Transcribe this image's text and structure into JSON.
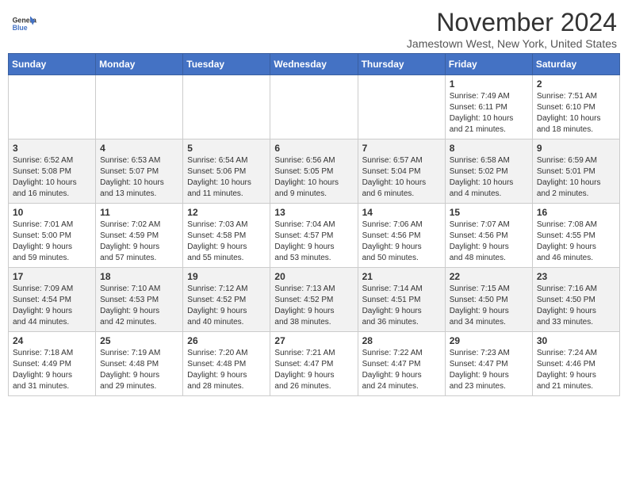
{
  "header": {
    "logo_line1": "General",
    "logo_line2": "Blue",
    "month_title": "November 2024",
    "location": "Jamestown West, New York, United States"
  },
  "weekdays": [
    "Sunday",
    "Monday",
    "Tuesday",
    "Wednesday",
    "Thursday",
    "Friday",
    "Saturday"
  ],
  "weeks": [
    [
      {
        "day": "",
        "info": ""
      },
      {
        "day": "",
        "info": ""
      },
      {
        "day": "",
        "info": ""
      },
      {
        "day": "",
        "info": ""
      },
      {
        "day": "",
        "info": ""
      },
      {
        "day": "1",
        "info": "Sunrise: 7:49 AM\nSunset: 6:11 PM\nDaylight: 10 hours\nand 21 minutes."
      },
      {
        "day": "2",
        "info": "Sunrise: 7:51 AM\nSunset: 6:10 PM\nDaylight: 10 hours\nand 18 minutes."
      }
    ],
    [
      {
        "day": "3",
        "info": "Sunrise: 6:52 AM\nSunset: 5:08 PM\nDaylight: 10 hours\nand 16 minutes."
      },
      {
        "day": "4",
        "info": "Sunrise: 6:53 AM\nSunset: 5:07 PM\nDaylight: 10 hours\nand 13 minutes."
      },
      {
        "day": "5",
        "info": "Sunrise: 6:54 AM\nSunset: 5:06 PM\nDaylight: 10 hours\nand 11 minutes."
      },
      {
        "day": "6",
        "info": "Sunrise: 6:56 AM\nSunset: 5:05 PM\nDaylight: 10 hours\nand 9 minutes."
      },
      {
        "day": "7",
        "info": "Sunrise: 6:57 AM\nSunset: 5:04 PM\nDaylight: 10 hours\nand 6 minutes."
      },
      {
        "day": "8",
        "info": "Sunrise: 6:58 AM\nSunset: 5:02 PM\nDaylight: 10 hours\nand 4 minutes."
      },
      {
        "day": "9",
        "info": "Sunrise: 6:59 AM\nSunset: 5:01 PM\nDaylight: 10 hours\nand 2 minutes."
      }
    ],
    [
      {
        "day": "10",
        "info": "Sunrise: 7:01 AM\nSunset: 5:00 PM\nDaylight: 9 hours\nand 59 minutes."
      },
      {
        "day": "11",
        "info": "Sunrise: 7:02 AM\nSunset: 4:59 PM\nDaylight: 9 hours\nand 57 minutes."
      },
      {
        "day": "12",
        "info": "Sunrise: 7:03 AM\nSunset: 4:58 PM\nDaylight: 9 hours\nand 55 minutes."
      },
      {
        "day": "13",
        "info": "Sunrise: 7:04 AM\nSunset: 4:57 PM\nDaylight: 9 hours\nand 53 minutes."
      },
      {
        "day": "14",
        "info": "Sunrise: 7:06 AM\nSunset: 4:56 PM\nDaylight: 9 hours\nand 50 minutes."
      },
      {
        "day": "15",
        "info": "Sunrise: 7:07 AM\nSunset: 4:56 PM\nDaylight: 9 hours\nand 48 minutes."
      },
      {
        "day": "16",
        "info": "Sunrise: 7:08 AM\nSunset: 4:55 PM\nDaylight: 9 hours\nand 46 minutes."
      }
    ],
    [
      {
        "day": "17",
        "info": "Sunrise: 7:09 AM\nSunset: 4:54 PM\nDaylight: 9 hours\nand 44 minutes."
      },
      {
        "day": "18",
        "info": "Sunrise: 7:10 AM\nSunset: 4:53 PM\nDaylight: 9 hours\nand 42 minutes."
      },
      {
        "day": "19",
        "info": "Sunrise: 7:12 AM\nSunset: 4:52 PM\nDaylight: 9 hours\nand 40 minutes."
      },
      {
        "day": "20",
        "info": "Sunrise: 7:13 AM\nSunset: 4:52 PM\nDaylight: 9 hours\nand 38 minutes."
      },
      {
        "day": "21",
        "info": "Sunrise: 7:14 AM\nSunset: 4:51 PM\nDaylight: 9 hours\nand 36 minutes."
      },
      {
        "day": "22",
        "info": "Sunrise: 7:15 AM\nSunset: 4:50 PM\nDaylight: 9 hours\nand 34 minutes."
      },
      {
        "day": "23",
        "info": "Sunrise: 7:16 AM\nSunset: 4:50 PM\nDaylight: 9 hours\nand 33 minutes."
      }
    ],
    [
      {
        "day": "24",
        "info": "Sunrise: 7:18 AM\nSunset: 4:49 PM\nDaylight: 9 hours\nand 31 minutes."
      },
      {
        "day": "25",
        "info": "Sunrise: 7:19 AM\nSunset: 4:48 PM\nDaylight: 9 hours\nand 29 minutes."
      },
      {
        "day": "26",
        "info": "Sunrise: 7:20 AM\nSunset: 4:48 PM\nDaylight: 9 hours\nand 28 minutes."
      },
      {
        "day": "27",
        "info": "Sunrise: 7:21 AM\nSunset: 4:47 PM\nDaylight: 9 hours\nand 26 minutes."
      },
      {
        "day": "28",
        "info": "Sunrise: 7:22 AM\nSunset: 4:47 PM\nDaylight: 9 hours\nand 24 minutes."
      },
      {
        "day": "29",
        "info": "Sunrise: 7:23 AM\nSunset: 4:47 PM\nDaylight: 9 hours\nand 23 minutes."
      },
      {
        "day": "30",
        "info": "Sunrise: 7:24 AM\nSunset: 4:46 PM\nDaylight: 9 hours\nand 21 minutes."
      }
    ]
  ]
}
